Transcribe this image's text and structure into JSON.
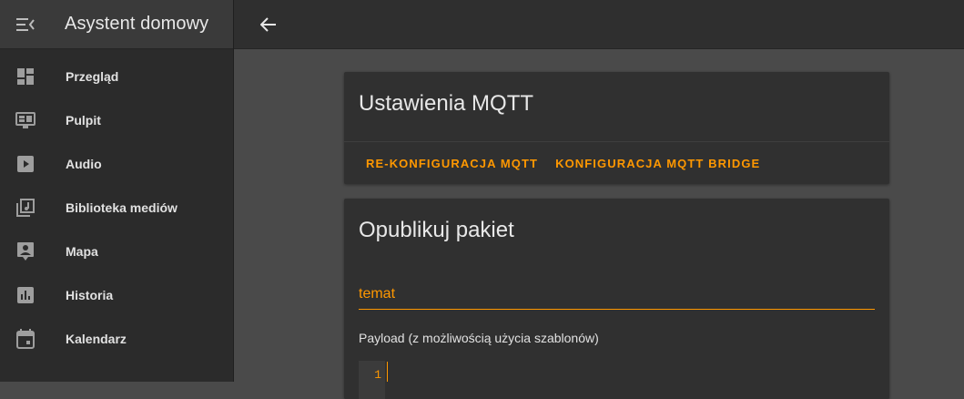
{
  "app": {
    "title": "Asystent domowy"
  },
  "sidebar": {
    "items": [
      {
        "label": "Przegląd",
        "icon": "dashboard-icon"
      },
      {
        "label": "Pulpit",
        "icon": "monitor-dashboard-icon"
      },
      {
        "label": "Audio",
        "icon": "play-box-icon"
      },
      {
        "label": "Biblioteka mediów",
        "icon": "music-library-icon"
      },
      {
        "label": "Mapa",
        "icon": "account-location-icon"
      },
      {
        "label": "Historia",
        "icon": "chart-box-icon"
      },
      {
        "label": "Kalendarz",
        "icon": "calendar-icon"
      }
    ]
  },
  "settings_card": {
    "title": "Ustawienia MQTT",
    "actions": [
      "RE-KONFIGURACJA MQTT",
      "KONFIGURACJA MQTT BRIDGE"
    ]
  },
  "publish_card": {
    "title": "Opublikuj pakiet",
    "topic_placeholder": "temat",
    "payload_label": "Payload (z możliwością użycia szablonów)",
    "line_number": "1"
  },
  "colors": {
    "accent": "#ff9800",
    "sidebar_bg": "#2b2b2b",
    "card_bg": "#303030",
    "page_bg": "#4a4a4a"
  }
}
